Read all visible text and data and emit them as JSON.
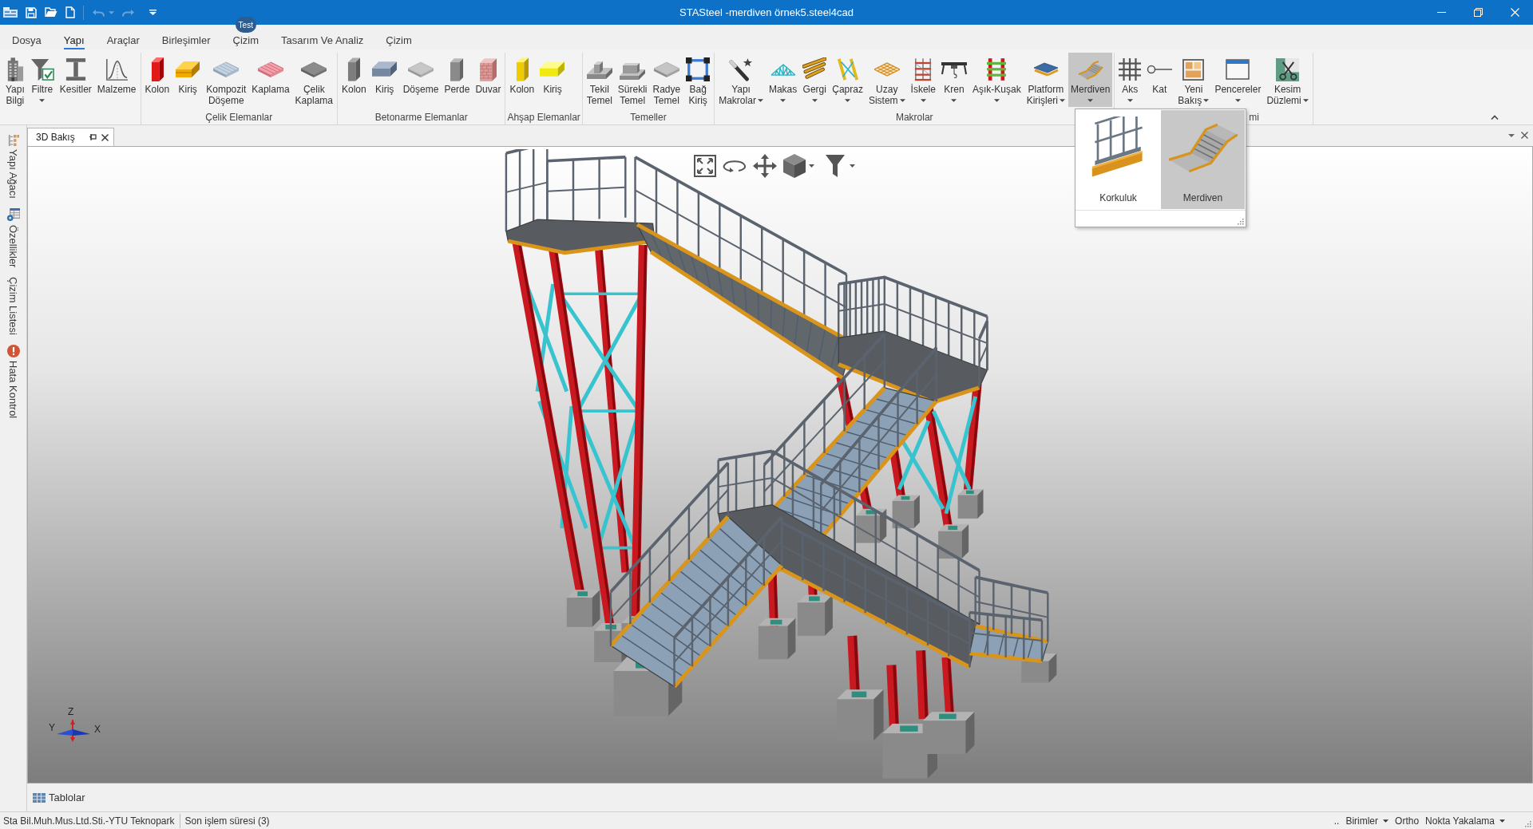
{
  "window": {
    "title": "STASteel -merdiven örnek5.steel4cad"
  },
  "quick_access": {
    "undo": {
      "disabled": true
    },
    "redo": {
      "disabled": true
    }
  },
  "menu_tabs": [
    {
      "label": "Dosya",
      "selected": false
    },
    {
      "label": "Yapı",
      "selected": true
    },
    {
      "label": "Araçlar",
      "selected": false
    },
    {
      "label": "Birleşimler",
      "selected": false
    },
    {
      "label": "Çizim",
      "selected": false,
      "badge": "Test"
    },
    {
      "label": "Tasarım Ve Analiz",
      "selected": false
    },
    {
      "label": "Çizim",
      "selected": false
    }
  ],
  "ribbon": {
    "groups": [
      {
        "buttons": [
          {
            "lines": [
              "Yapı",
              "Bilgi"
            ],
            "dropdown": false,
            "pressed": false
          },
          {
            "lines": [
              "Filtre"
            ],
            "dropdown": true,
            "pressed": false
          },
          {
            "lines": [
              "Kesitler"
            ],
            "dropdown": false,
            "pressed": false
          },
          {
            "lines": [
              "Malzeme"
            ],
            "dropdown": false,
            "pressed": false
          }
        ]
      },
      {
        "label": "Çelik Elemanlar",
        "buttons": [
          {
            "lines": [
              "Kolon"
            ],
            "dropdown": false,
            "pressed": false
          },
          {
            "lines": [
              "Kiriş"
            ],
            "dropdown": false,
            "pressed": false
          },
          {
            "lines": [
              "Kompozit",
              "Döşeme"
            ],
            "dropdown": false,
            "pressed": false
          },
          {
            "lines": [
              "Kaplama"
            ],
            "dropdown": false,
            "pressed": false
          },
          {
            "lines": [
              "Çelik",
              "Kaplama"
            ],
            "dropdown": false,
            "pressed": false
          }
        ]
      },
      {
        "label": "Betonarme Elemanlar",
        "buttons": [
          {
            "lines": [
              "Kolon"
            ],
            "dropdown": false,
            "pressed": false
          },
          {
            "lines": [
              "Kiriş"
            ],
            "dropdown": false,
            "pressed": false
          },
          {
            "lines": [
              "Döşeme"
            ],
            "dropdown": false,
            "pressed": false
          },
          {
            "lines": [
              "Perde"
            ],
            "dropdown": false,
            "pressed": false
          },
          {
            "lines": [
              "Duvar"
            ],
            "dropdown": false,
            "pressed": false
          }
        ]
      },
      {
        "label": "Ahşap Elemanlar",
        "buttons": [
          {
            "lines": [
              "Kolon"
            ],
            "dropdown": false,
            "pressed": false
          },
          {
            "lines": [
              "Kiriş"
            ],
            "dropdown": false,
            "pressed": false
          }
        ]
      },
      {
        "label": "Temeller",
        "buttons": [
          {
            "lines": [
              "Tekil",
              "Temel"
            ],
            "dropdown": false,
            "pressed": false
          },
          {
            "lines": [
              "Sürekli",
              "Temel"
            ],
            "dropdown": false,
            "pressed": false
          },
          {
            "lines": [
              "Radye",
              "Temel"
            ],
            "dropdown": false,
            "pressed": false
          },
          {
            "lines": [
              "Bağ",
              "Kiriş"
            ],
            "dropdown": false,
            "pressed": false
          }
        ]
      },
      {
        "label": "Makrolar",
        "buttons": [
          {
            "lines": [
              "Yapı",
              "Makrolar"
            ],
            "dropdown": true,
            "pressed": false
          },
          {
            "lines": [
              "Makas"
            ],
            "dropdown": true,
            "pressed": false
          },
          {
            "lines": [
              "Gergi"
            ],
            "dropdown": true,
            "pressed": false
          },
          {
            "lines": [
              "Çapraz"
            ],
            "dropdown": true,
            "pressed": false
          },
          {
            "lines": [
              "Uzay",
              "Sistem"
            ],
            "dropdown": true,
            "pressed": false
          },
          {
            "lines": [
              "İskele"
            ],
            "dropdown": true,
            "pressed": false
          },
          {
            "lines": [
              "Kren"
            ],
            "dropdown": true,
            "pressed": false
          },
          {
            "lines": [
              "Aşık-Kuşak"
            ],
            "dropdown": true,
            "pressed": false
          },
          {
            "lines": [
              "Platform",
              "Kirişleri"
            ],
            "dropdown": true,
            "pressed": false
          },
          {
            "lines": [
              "Merdiven"
            ],
            "dropdown": true,
            "pressed": true
          }
        ]
      },
      {
        "label": "mi",
        "buttons": [
          {
            "lines": [
              "Aks"
            ],
            "dropdown": true,
            "pressed": false
          },
          {
            "lines": [
              "Kat"
            ],
            "dropdown": false,
            "pressed": false
          },
          {
            "lines": [
              "Yeni",
              "Bakış"
            ],
            "dropdown": true,
            "pressed": false
          },
          {
            "lines": [
              "Pencereler"
            ],
            "dropdown": true,
            "pressed": false
          },
          {
            "lines": [
              "Kesim",
              "Düzlemi"
            ],
            "dropdown": true,
            "pressed": false
          }
        ]
      }
    ]
  },
  "gallery_popup": {
    "items": [
      {
        "label": "Korkuluk",
        "selected": false
      },
      {
        "label": "Merdiven",
        "selected": true
      }
    ]
  },
  "side_tabs": [
    "Yapı Ağacı",
    "Özellikler",
    "Çizim Listesi",
    "Hata Kontrol"
  ],
  "document_tabs": [
    {
      "label": "3D Bakış",
      "selected": true
    }
  ],
  "viewport": {
    "axes": {
      "z": "Z",
      "y": "Y",
      "x": "X"
    }
  },
  "bottom_tabs": [
    "Tablolar"
  ],
  "status_bar": {
    "left": [
      "Sta Bil.Muh.Mus.Ltd.Sti.-YTU Teknopark",
      "Son işlem süresi (3)"
    ],
    "right": [
      {
        "label": "..",
        "dropdown": false
      },
      {
        "label": "Birimler",
        "dropdown": true
      },
      {
        "label": "Ortho",
        "dropdown": false
      },
      {
        "label": "Nokta Yakalama",
        "dropdown": true
      }
    ]
  }
}
